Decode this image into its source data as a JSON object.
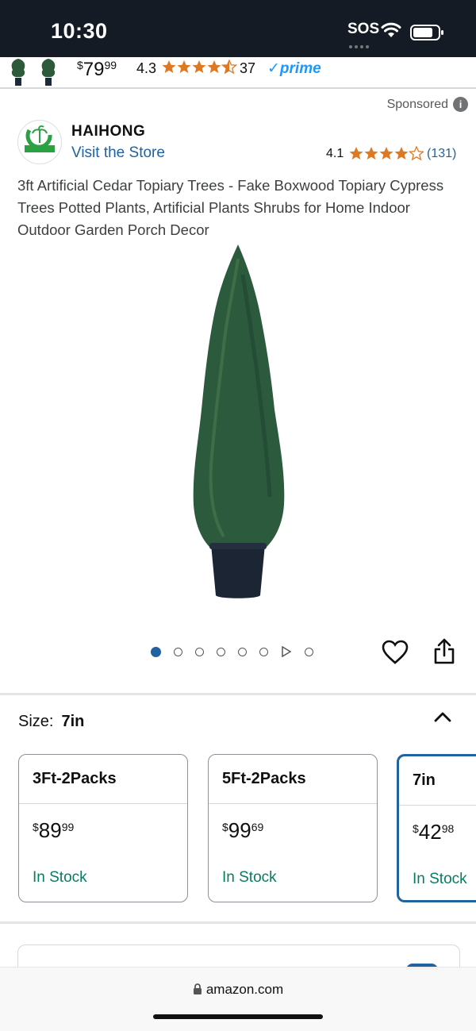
{
  "status_bar": {
    "time": "10:30",
    "sos": "SOS"
  },
  "sticky_bar": {
    "price_whole": "79",
    "price_cents": "99",
    "currency": "$",
    "rating": "4.3",
    "review_count": "37",
    "prime_label": "prime"
  },
  "sponsored": {
    "label": "Sponsored"
  },
  "brand": {
    "name": "HAIHONG",
    "visit_store": "Visit the Store",
    "rating": "4.1",
    "review_count": "(131)"
  },
  "product": {
    "title": "3ft Artificial Cedar Topiary Trees - Fake Boxwood Topiary Cypress Trees Potted Plants, Artificial Plants Shrubs for Home Indoor Outdoor Garden Porch Decor"
  },
  "carousel": {
    "total_images": 8,
    "active_index": 0,
    "video_index": 6
  },
  "size_selector": {
    "label": "Size:",
    "selected": "7in",
    "options": [
      {
        "name": "3Ft-2Packs",
        "currency": "$",
        "whole": "89",
        "cents": "99",
        "stock": "In Stock"
      },
      {
        "name": "5Ft-2Packs",
        "currency": "$",
        "whole": "99",
        "cents": "69",
        "stock": "In Stock"
      },
      {
        "name": "7in",
        "currency": "$",
        "whole": "42",
        "cents": "98",
        "stock": "In Stock"
      }
    ]
  },
  "browser": {
    "url": "amazon.com"
  },
  "colors": {
    "link": "#2162a1",
    "star": "#de7921",
    "stock": "#067d62",
    "prime": "#1a98ff"
  }
}
